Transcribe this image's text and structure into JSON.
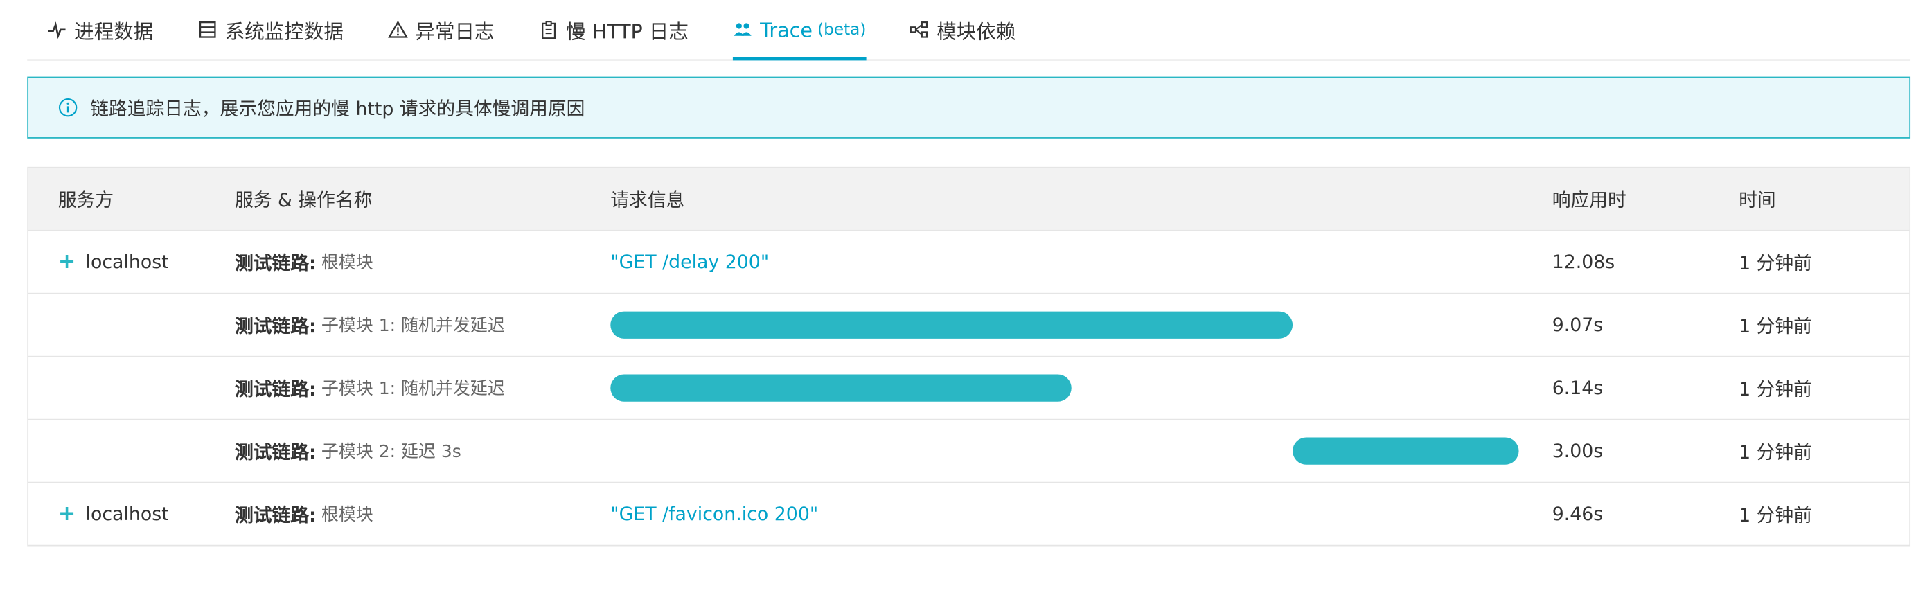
{
  "tabs": [
    {
      "label": "进程数据",
      "icon": "pulse-icon",
      "active": false
    },
    {
      "label": "系统监控数据",
      "icon": "server-icon",
      "active": false
    },
    {
      "label": "异常日志",
      "icon": "warning-icon",
      "active": false
    },
    {
      "label": "慢 HTTP 日志",
      "icon": "clipboard-icon",
      "active": false
    },
    {
      "label": "Trace",
      "beta": "(beta)",
      "icon": "users-icon",
      "active": true
    },
    {
      "label": "模块依赖",
      "icon": "module-icon",
      "active": false
    }
  ],
  "notice": {
    "text": "链路追踪日志，展示您应用的慢 http 请求的具体慢调用原因",
    "icon": "info-icon"
  },
  "table": {
    "headers": [
      "服务方",
      "服务 & 操作名称",
      "请求信息",
      "响应用时",
      "时间"
    ],
    "rows": [
      {
        "service": "localhost",
        "expand": "+",
        "op_strong": "测试链路:",
        "op_sub": "根模块",
        "request": "\"GET /delay 200\"",
        "duration": "12.08s",
        "time": "1 分钟前"
      },
      {
        "service": "",
        "op_strong": "测试链路:",
        "op_sub": "子模块 1: 随机并发延迟",
        "bar_start": 0.0,
        "bar_fraction": 0.751,
        "duration": "9.07s",
        "time": "1 分钟前"
      },
      {
        "service": "",
        "op_strong": "测试链路:",
        "op_sub": "子模块 1: 随机并发延迟",
        "bar_start": 0.0,
        "bar_fraction": 0.508,
        "duration": "6.14s",
        "time": "1 分钟前"
      },
      {
        "service": "",
        "op_strong": "测试链路:",
        "op_sub": "子模块 2: 延迟 3s",
        "bar_start": 0.751,
        "bar_fraction": 0.249,
        "duration": "3.00s",
        "time": "1 分钟前"
      },
      {
        "service": "localhost",
        "expand": "+",
        "op_strong": "测试链路:",
        "op_sub": "根模块",
        "request": "\"GET /favicon.ico 200\"",
        "duration": "9.46s",
        "time": "1 分钟前"
      }
    ]
  },
  "colors": {
    "accent": "#00a2c9",
    "bar": "#2ab7c4",
    "notice_bg": "#e8f8fb"
  }
}
